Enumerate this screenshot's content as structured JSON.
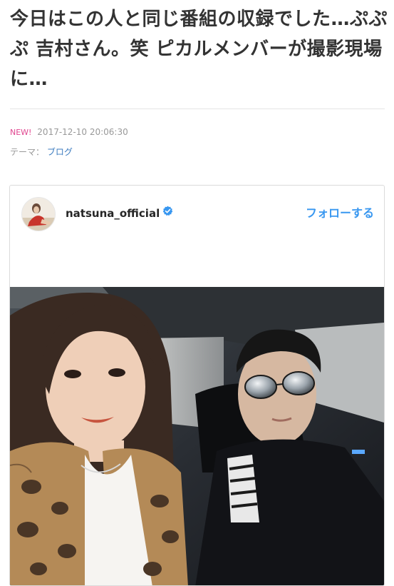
{
  "article": {
    "title": "今日はこの人と同じ番組の収録でした…ぷぷぷ 吉村さん。笑 ピカルメンバーが撮影現場に…",
    "new_badge": "NEW!",
    "date": "2017-12-10 20:06:30",
    "theme_label": "テーマ：",
    "theme_value": "ブログ"
  },
  "embed": {
    "username": "natsuna_official",
    "follow_label": "フォローする",
    "verified_icon": "verified-badge-icon",
    "colors": {
      "accent": "#3897f0",
      "new_badge": "#e0458f",
      "link": "#3b7bbf"
    }
  }
}
